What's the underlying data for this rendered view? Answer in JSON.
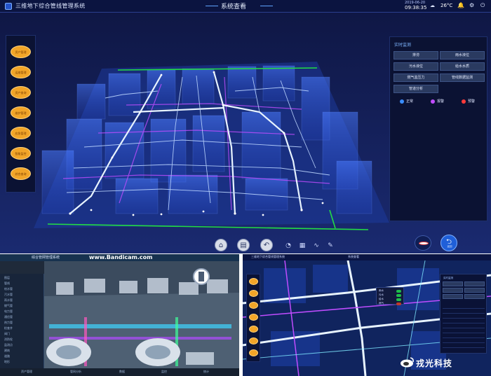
{
  "main": {
    "app_title": "三维地下综合管线管理系统",
    "center_title": "系统查看",
    "date": "2019-06-20",
    "time": "09:38:35",
    "weather_icon": "cloud-icon",
    "temperature": "26°C",
    "left_menu": [
      "资产管理",
      "运维管理",
      "资产查询",
      "维护管理",
      "应急管理",
      "智能监控",
      "综合查询"
    ],
    "right_panel": {
      "title": "实时监测",
      "buttons": [
        "排涝",
        "雨水液位",
        "污水液位",
        "给水水质",
        "燃气监压力",
        "管线数据监测",
        "管道分析"
      ],
      "legend": [
        {
          "label": "正常",
          "color": "#3a8dff"
        },
        {
          "label": "报警",
          "color": "#c04cff"
        },
        {
          "label": "预警",
          "color": "#ff3a3a"
        }
      ]
    },
    "bottom_toolbar": [
      "home-icon",
      "document-icon",
      "back-arrow-icon",
      "chart-icon",
      "grid-icon",
      "wave-icon",
      "measure-icon"
    ],
    "back_label": "返回"
  },
  "bottom_left": {
    "title": "综合管网管理系统",
    "recorder": "www.Bandicam.com",
    "tree": [
      "图层",
      "管线",
      "给水管",
      "污水管",
      "雨水管",
      "燃气管",
      "电力管",
      "通信管",
      "热力管",
      "检查井",
      "阀门",
      "消防栓",
      "监测点",
      "建筑",
      "道路",
      "地形"
    ],
    "footer": [
      "资产管理",
      "管网分析",
      "数据",
      "监控",
      "统计"
    ]
  },
  "bottom_right": {
    "title": "三维地下综合管线管理系统",
    "tab": "系统查看",
    "popup": [
      "雨水",
      "污水",
      "给水",
      "燃气"
    ],
    "panel_title": "实时监测"
  },
  "watermark": "戎光科技",
  "colors": {
    "bg_main": "#101a4a",
    "pipe": "#e8f4ff",
    "accent": "#f2a528",
    "green_line": "#22dd44"
  }
}
